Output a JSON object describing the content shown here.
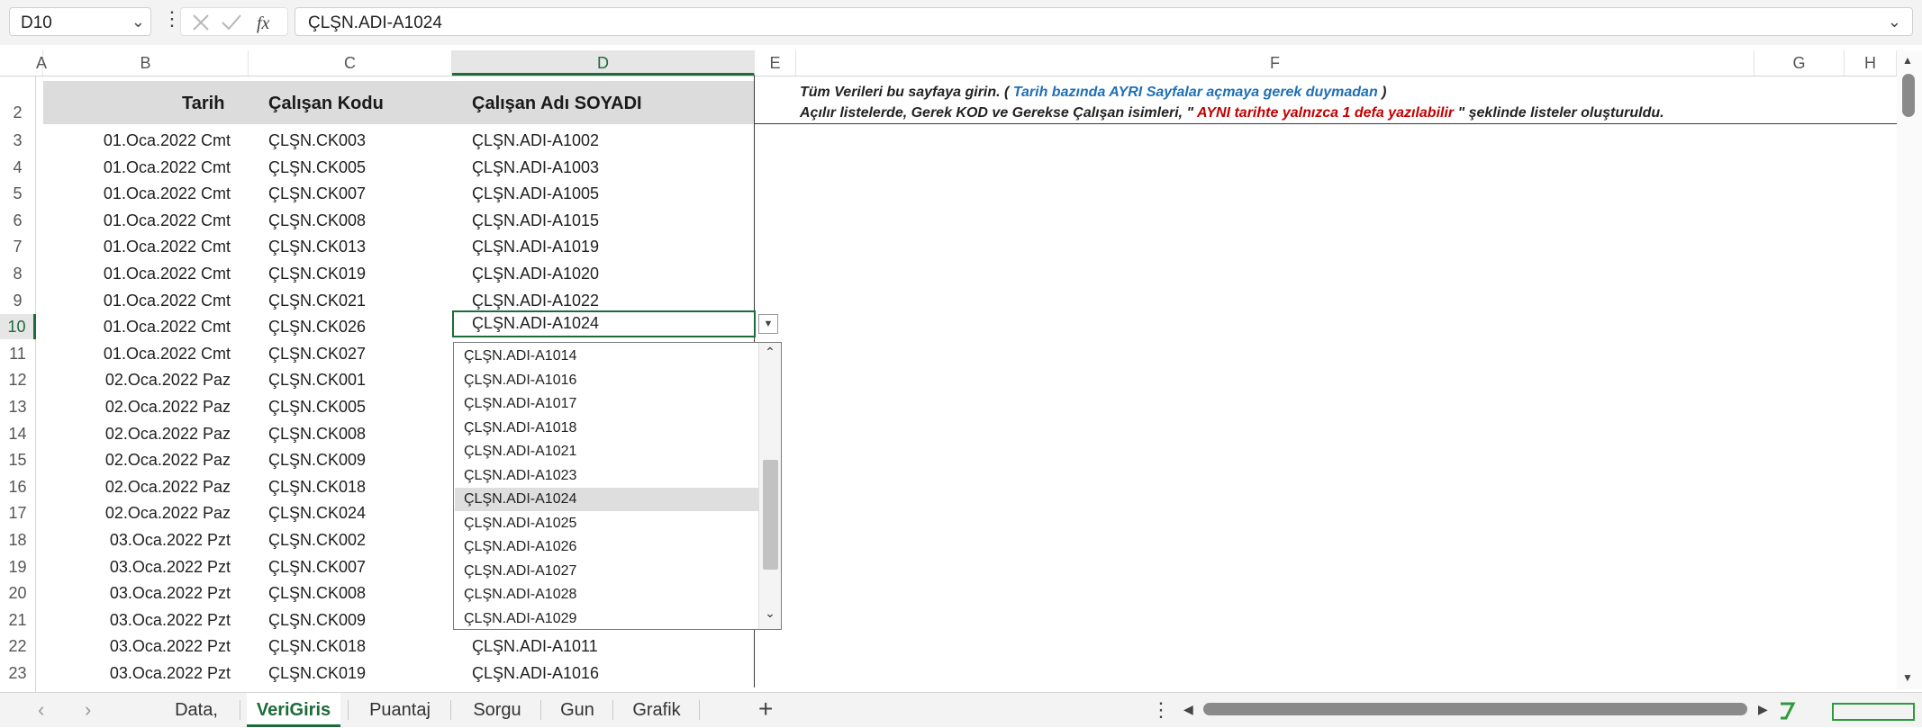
{
  "name_box": "D10",
  "formula": "ÇLŞN.ADI-A1024",
  "columns": [
    "A",
    "B",
    "C",
    "D",
    "E",
    "F",
    "G",
    "H"
  ],
  "header_row": {
    "row": "2",
    "tarih": "Tarih",
    "kod": "Çalışan Kodu",
    "ad": "Çalışan Adı SOYADI"
  },
  "notes": {
    "line1_a": "Tüm Verileri bu sayfaya girin. (",
    "line1_b": " Tarih bazında AYRI Sayfalar açmaya gerek duymadan",
    "line1_c": " )",
    "line2_a": "Açılır listelerde, Gerek KOD ve Gerekse Çalışan isimleri, \"",
    "line2_b": " AYNI tarihte yalnızca 1 defa yazılabilir",
    "line2_c": " \" şeklinde listeler oluşturuldu."
  },
  "rows": [
    {
      "n": "3",
      "date": "01.Oca.2022 Cmt",
      "code": "ÇLŞN.CK003",
      "name": "ÇLŞN.ADI-A1002"
    },
    {
      "n": "4",
      "date": "01.Oca.2022 Cmt",
      "code": "ÇLŞN.CK005",
      "name": "ÇLŞN.ADI-A1003"
    },
    {
      "n": "5",
      "date": "01.Oca.2022 Cmt",
      "code": "ÇLŞN.CK007",
      "name": "ÇLŞN.ADI-A1005"
    },
    {
      "n": "6",
      "date": "01.Oca.2022 Cmt",
      "code": "ÇLŞN.CK008",
      "name": "ÇLŞN.ADI-A1015"
    },
    {
      "n": "7",
      "date": "01.Oca.2022 Cmt",
      "code": "ÇLŞN.CK013",
      "name": "ÇLŞN.ADI-A1019"
    },
    {
      "n": "8",
      "date": "01.Oca.2022 Cmt",
      "code": "ÇLŞN.CK019",
      "name": "ÇLŞN.ADI-A1020"
    },
    {
      "n": "9",
      "date": "01.Oca.2022 Cmt",
      "code": "ÇLŞN.CK021",
      "name": "ÇLŞN.ADI-A1022"
    },
    {
      "n": "10",
      "date": "01.Oca.2022 Cmt",
      "code": "ÇLŞN.CK026",
      "name": "ÇLŞN.ADI-A1024"
    },
    {
      "n": "11",
      "date": "01.Oca.2022 Cmt",
      "code": "ÇLŞN.CK027",
      "name": ""
    },
    {
      "n": "12",
      "date": "02.Oca.2022 Paz",
      "code": "ÇLŞN.CK001",
      "name": ""
    },
    {
      "n": "13",
      "date": "02.Oca.2022 Paz",
      "code": "ÇLŞN.CK005",
      "name": ""
    },
    {
      "n": "14",
      "date": "02.Oca.2022 Paz",
      "code": "ÇLŞN.CK008",
      "name": ""
    },
    {
      "n": "15",
      "date": "02.Oca.2022 Paz",
      "code": "ÇLŞN.CK009",
      "name": ""
    },
    {
      "n": "16",
      "date": "02.Oca.2022 Paz",
      "code": "ÇLŞN.CK018",
      "name": ""
    },
    {
      "n": "17",
      "date": "02.Oca.2022 Paz",
      "code": "ÇLŞN.CK024",
      "name": ""
    },
    {
      "n": "18",
      "date": "03.Oca.2022 Pzt",
      "code": "ÇLŞN.CK002",
      "name": ""
    },
    {
      "n": "19",
      "date": "03.Oca.2022 Pzt",
      "code": "ÇLŞN.CK007",
      "name": ""
    },
    {
      "n": "20",
      "date": "03.Oca.2022 Pzt",
      "code": "ÇLŞN.CK008",
      "name": ""
    },
    {
      "n": "21",
      "date": "03.Oca.2022 Pzt",
      "code": "ÇLŞN.CK009",
      "name": ""
    },
    {
      "n": "22",
      "date": "03.Oca.2022 Pzt",
      "code": "ÇLŞN.CK018",
      "name": "ÇLŞN.ADI-A1011"
    },
    {
      "n": "23",
      "date": "03.Oca.2022 Pzt",
      "code": "ÇLŞN.CK019",
      "name": "ÇLŞN.ADI-A1016"
    }
  ],
  "dropdown": {
    "items": [
      "ÇLŞN.ADI-A1014",
      "ÇLŞN.ADI-A1016",
      "ÇLŞN.ADI-A1017",
      "ÇLŞN.ADI-A1018",
      "ÇLŞN.ADI-A1021",
      "ÇLŞN.ADI-A1023",
      "ÇLŞN.ADI-A1024",
      "ÇLŞN.ADI-A1025",
      "ÇLŞN.ADI-A1026",
      "ÇLŞN.ADI-A1027",
      "ÇLŞN.ADI-A1028",
      "ÇLŞN.ADI-A1029"
    ],
    "selected": "ÇLŞN.ADI-A1024"
  },
  "tabs": [
    "Data,",
    "VeriGiris",
    "Puantaj",
    "Sorgu",
    "Gun",
    "Grafik"
  ],
  "active_tab": "VeriGiris",
  "colors": {
    "accent": "#1e6b3a",
    "note_blue": "#1f6fb5",
    "note_red": "#c00000",
    "header_band": "#dcdcdc"
  }
}
